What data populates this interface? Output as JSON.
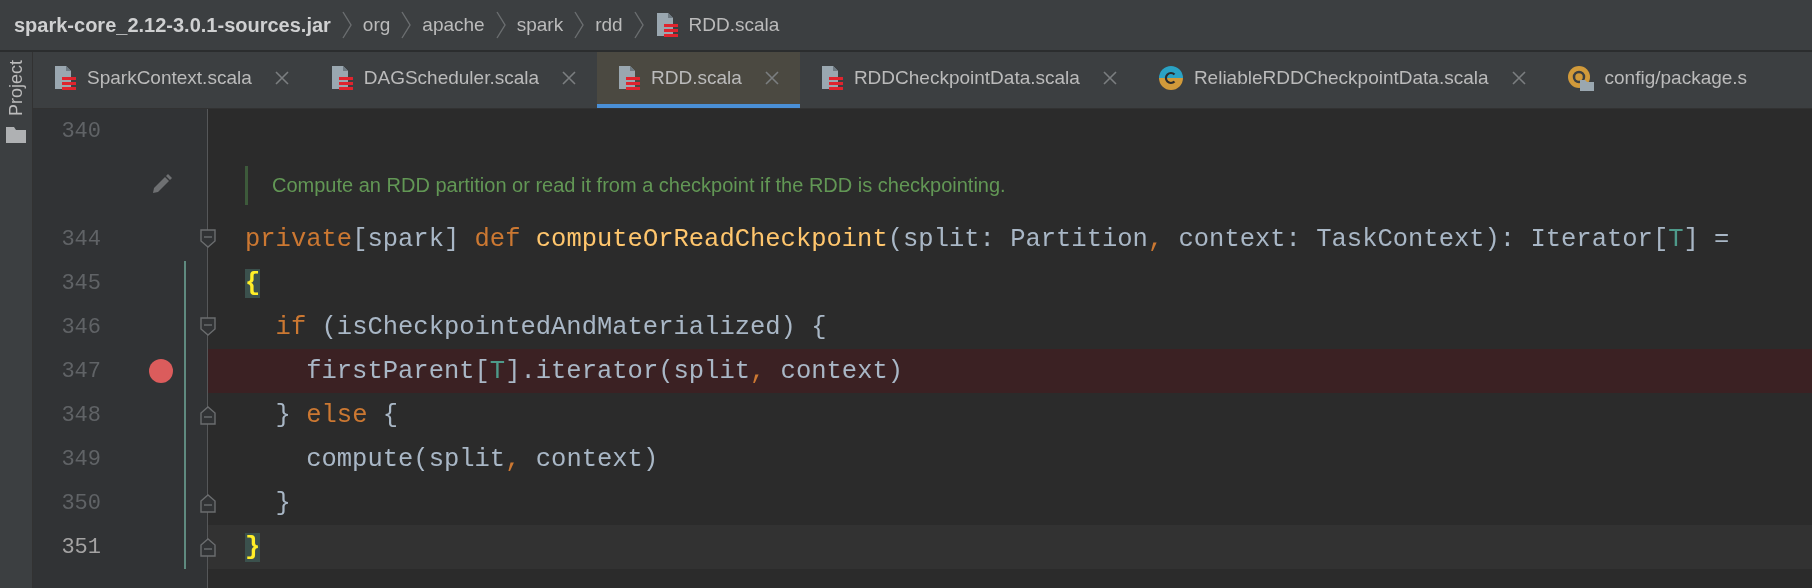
{
  "breadcrumbs": [
    {
      "label": "spark-core_2.12-3.0.1-sources.jar",
      "kind": "archive"
    },
    {
      "label": "org",
      "kind": "package"
    },
    {
      "label": "apache",
      "kind": "package"
    },
    {
      "label": "spark",
      "kind": "package"
    },
    {
      "label": "rdd",
      "kind": "package"
    },
    {
      "label": "RDD.scala",
      "kind": "scala-file"
    }
  ],
  "tool_strip": {
    "label": "Project"
  },
  "tabs": [
    {
      "label": "SparkContext.scala",
      "kind": "scala-file",
      "selected": false,
      "closable": true
    },
    {
      "label": "DAGScheduler.scala",
      "kind": "scala-file",
      "selected": false,
      "closable": true
    },
    {
      "label": "RDD.scala",
      "kind": "scala-file",
      "selected": true,
      "closable": true
    },
    {
      "label": "RDDCheckpointData.scala",
      "kind": "scala-file",
      "selected": false,
      "closable": true
    },
    {
      "label": "ReliableRDDCheckpointData.scala",
      "kind": "scala-class",
      "selected": false,
      "closable": true
    },
    {
      "label": "config/package.s",
      "kind": "package-object",
      "selected": false,
      "closable": false
    }
  ],
  "editor": {
    "lines": [
      {
        "kind": "code",
        "number": "340",
        "fold_start": false,
        "fold_end": false,
        "breakpoint": false,
        "current": false,
        "changed": false
      },
      {
        "kind": "doc",
        "text": "Compute an RDD partition or read it from a checkpoint if the RDD is checkpointing."
      },
      {
        "kind": "code",
        "number": "344",
        "fold_start": true,
        "fold_end": false,
        "breakpoint": false,
        "current": false,
        "changed": false,
        "tokens": [
          {
            "kind": "keyword",
            "text": "private"
          },
          {
            "kind": "plain",
            "text": "[spark] "
          },
          {
            "kind": "keyword",
            "text": "def"
          },
          {
            "kind": "function",
            "text": " computeOrReadCheckpoint"
          },
          {
            "kind": "plain",
            "text": "(split: Partition"
          },
          {
            "kind": "keyword",
            "text": ","
          },
          {
            "kind": "plain",
            "text": " context: TaskContext): Iterator["
          },
          {
            "kind": "type-param",
            "text": "T"
          },
          {
            "kind": "plain",
            "text": "] ="
          }
        ]
      },
      {
        "kind": "code",
        "number": "345",
        "fold_start": false,
        "fold_end": false,
        "breakpoint": false,
        "current": false,
        "changed": true,
        "tokens": [
          {
            "kind": "brace",
            "text": "{"
          }
        ]
      },
      {
        "kind": "code",
        "number": "346",
        "fold_start": true,
        "fold_end": false,
        "breakpoint": false,
        "current": false,
        "changed": true,
        "tokens": [
          {
            "kind": "keyword",
            "text": "  if"
          },
          {
            "kind": "plain",
            "text": " (isCheckpointedAndMaterialized) {"
          }
        ]
      },
      {
        "kind": "code",
        "number": "347",
        "fold_start": false,
        "fold_end": false,
        "breakpoint": true,
        "current": false,
        "changed": true,
        "tokens": [
          {
            "kind": "plain",
            "text": "    firstParent["
          },
          {
            "kind": "type-param",
            "text": "T"
          },
          {
            "kind": "plain",
            "text": "].iterator(split"
          },
          {
            "kind": "keyword",
            "text": ","
          },
          {
            "kind": "plain",
            "text": " context)"
          }
        ]
      },
      {
        "kind": "code",
        "number": "348",
        "fold_start": false,
        "fold_end": true,
        "breakpoint": false,
        "current": false,
        "changed": true,
        "tokens": [
          {
            "kind": "plain",
            "text": "  } "
          },
          {
            "kind": "keyword",
            "text": "else"
          },
          {
            "kind": "plain",
            "text": " {"
          }
        ]
      },
      {
        "kind": "code",
        "number": "349",
        "fold_start": false,
        "fold_end": false,
        "breakpoint": false,
        "current": false,
        "changed": true,
        "tokens": [
          {
            "kind": "plain",
            "text": "    compute(split"
          },
          {
            "kind": "keyword",
            "text": ","
          },
          {
            "kind": "plain",
            "text": " context)"
          }
        ]
      },
      {
        "kind": "code",
        "number": "350",
        "fold_start": false,
        "fold_end": true,
        "breakpoint": false,
        "current": false,
        "changed": true,
        "tokens": [
          {
            "kind": "plain",
            "text": "  }"
          }
        ]
      },
      {
        "kind": "code",
        "number": "351",
        "fold_start": false,
        "fold_end": true,
        "breakpoint": false,
        "current": true,
        "changed": true,
        "tokens": [
          {
            "kind": "brace",
            "text": "}"
          }
        ]
      }
    ]
  }
}
